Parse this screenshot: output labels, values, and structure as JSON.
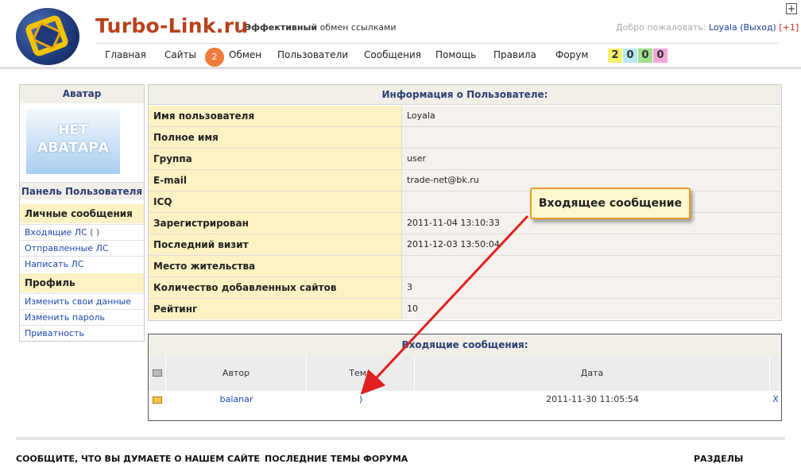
{
  "header": {
    "site_title": "Turbo-Link.ru",
    "tagline_bold": "Эффективный",
    "tagline_rest": " обмен ссылками",
    "welcome_prefix": "Добро пожаловать: ",
    "username": "Loyala",
    "logout_label": "(Выход)",
    "plus_one": "[+1]",
    "corner_button": "+"
  },
  "nav": {
    "items": [
      "Главная",
      "Сайты",
      "Обмен",
      "Пользователи",
      "Сообщения",
      "Помощь",
      "Правила",
      "Форум"
    ],
    "badge": "2",
    "counters": [
      {
        "value": "2",
        "color": "#f5f06d"
      },
      {
        "value": "0",
        "color": "#b7e8f5"
      },
      {
        "value": "0",
        "color": "#9fe08a"
      },
      {
        "value": "0",
        "color": "#f5a6d9"
      }
    ]
  },
  "sidebar": {
    "avatar_title": "Аватар",
    "avatar_text_1": "НЕТ",
    "avatar_text_2": "АВАТАРА",
    "panel_title": "Панель Пользователя",
    "section_messages": "Личные сообщения",
    "inbox_label": "Входящие ЛС",
    "inbox_count": "( )",
    "sent_label": "Отправленные ЛС",
    "write_label": "Написать ЛС",
    "section_profile": "Профиль",
    "edit_data_label": "Изменить свои данные",
    "change_password_label": "Изменить пароль",
    "privacy_label": "Приватность"
  },
  "info": {
    "title": "Информация о Пользователе:",
    "rows": [
      {
        "key": "Имя пользователя",
        "value": "Loyala"
      },
      {
        "key": "Полное имя",
        "value": ""
      },
      {
        "key": "Группа",
        "value": "user"
      },
      {
        "key": "E-mail",
        "value": "trade-net@bk.ru"
      },
      {
        "key": "ICQ",
        "value": ""
      },
      {
        "key": "Зарегистрирован",
        "value": "2011-11-04 13:10:33"
      },
      {
        "key": "Последний визит",
        "value": "2011-12-03 13:50:04"
      },
      {
        "key": "Место жительства",
        "value": ""
      },
      {
        "key": "Количество добавленных сайтов",
        "value": "3"
      },
      {
        "key": "Рейтинг",
        "value": "10"
      }
    ]
  },
  "messages": {
    "title": "Входящие сообщения:",
    "columns": {
      "author": "Автор",
      "subject": "Тема",
      "date": "Дата"
    },
    "rows": [
      {
        "author": "balanar",
        "subject": ")",
        "date": "2011-11-30 11:05:54",
        "delete": "X"
      }
    ]
  },
  "annotation": {
    "callout_text": "Входящее сообщение",
    "color": "#e02020"
  },
  "footer": {
    "col1": "СООБЩИТЕ, ЧТО ВЫ ДУМАЕТЕ О НАШЕМ САЙТЕ",
    "col2": "ПОСЛЕДНИЕ ТЕМЫ ФОРУМА",
    "col3": "РАЗДЕЛЫ"
  }
}
